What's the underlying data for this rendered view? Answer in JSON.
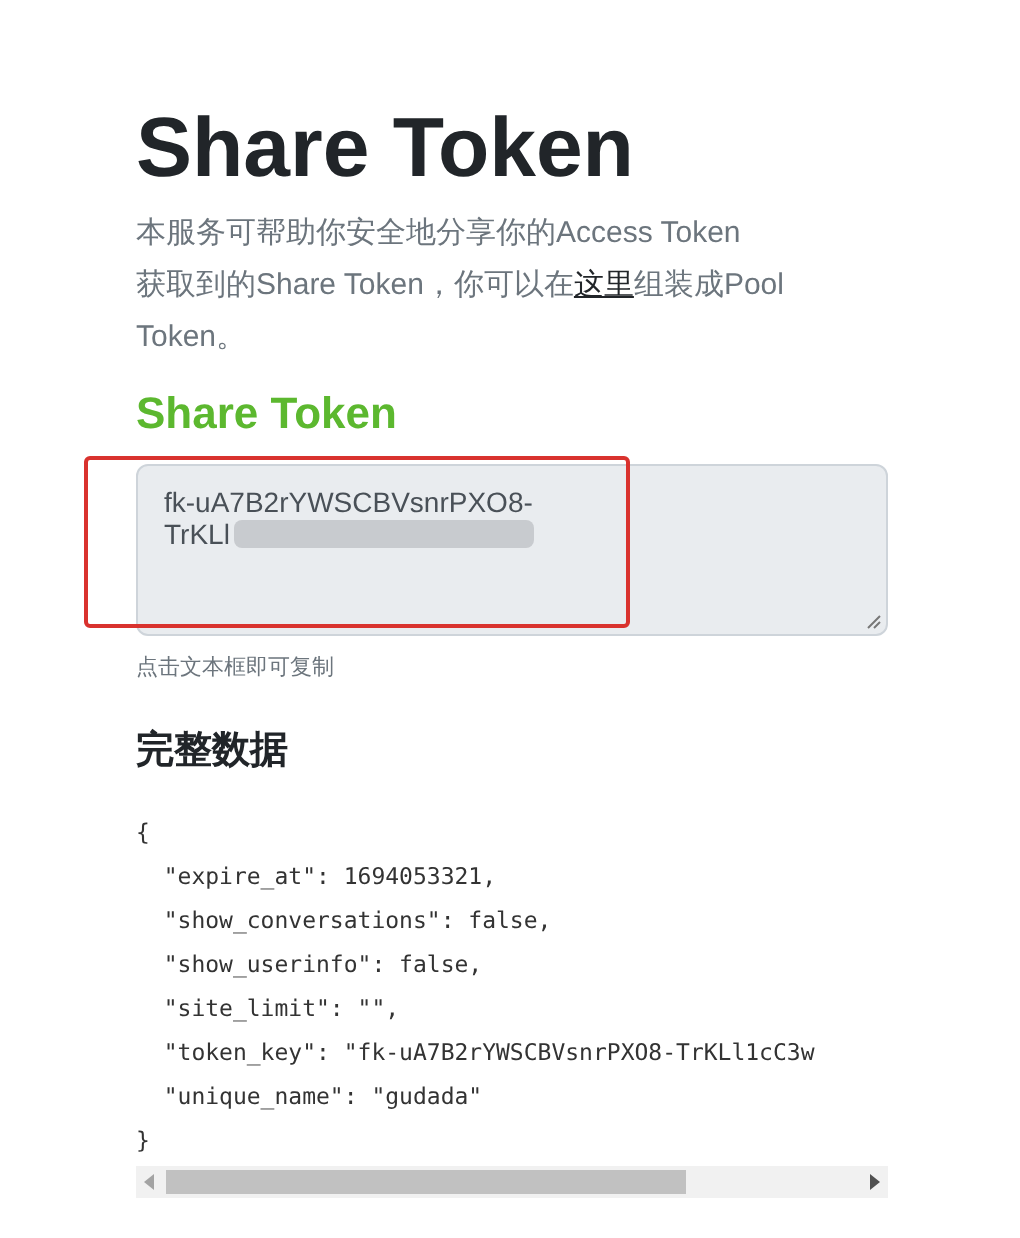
{
  "title": "Share Token",
  "description": {
    "line_1": "本服务可帮助你安全地分享你的Access Token",
    "line_2_before": "获取到的Share Token，你可以在",
    "line_2_link": "这里",
    "line_2_after": "组装成Pool Token。"
  },
  "share_token": {
    "heading": "Share Token",
    "value_lines": [
      "fk-uA7B2rYWSCBVsnrPXO8-",
      "TrKLl"
    ],
    "hint": "点击文本框即可复制",
    "redacted": true,
    "highlighted": true
  },
  "full_data": {
    "heading": "完整数据",
    "lines": [
      "{",
      "  \"expire_at\": 1694053321,",
      "  \"show_conversations\": false,",
      "  \"show_userinfo\": false,",
      "  \"site_limit\": \"\",",
      "  \"token_key\": \"fk-uA7B2rYWSCBVsnrPXO8-TrKLl1cC3w",
      "  \"unique_name\": \"gudada\"",
      "}"
    ]
  }
}
